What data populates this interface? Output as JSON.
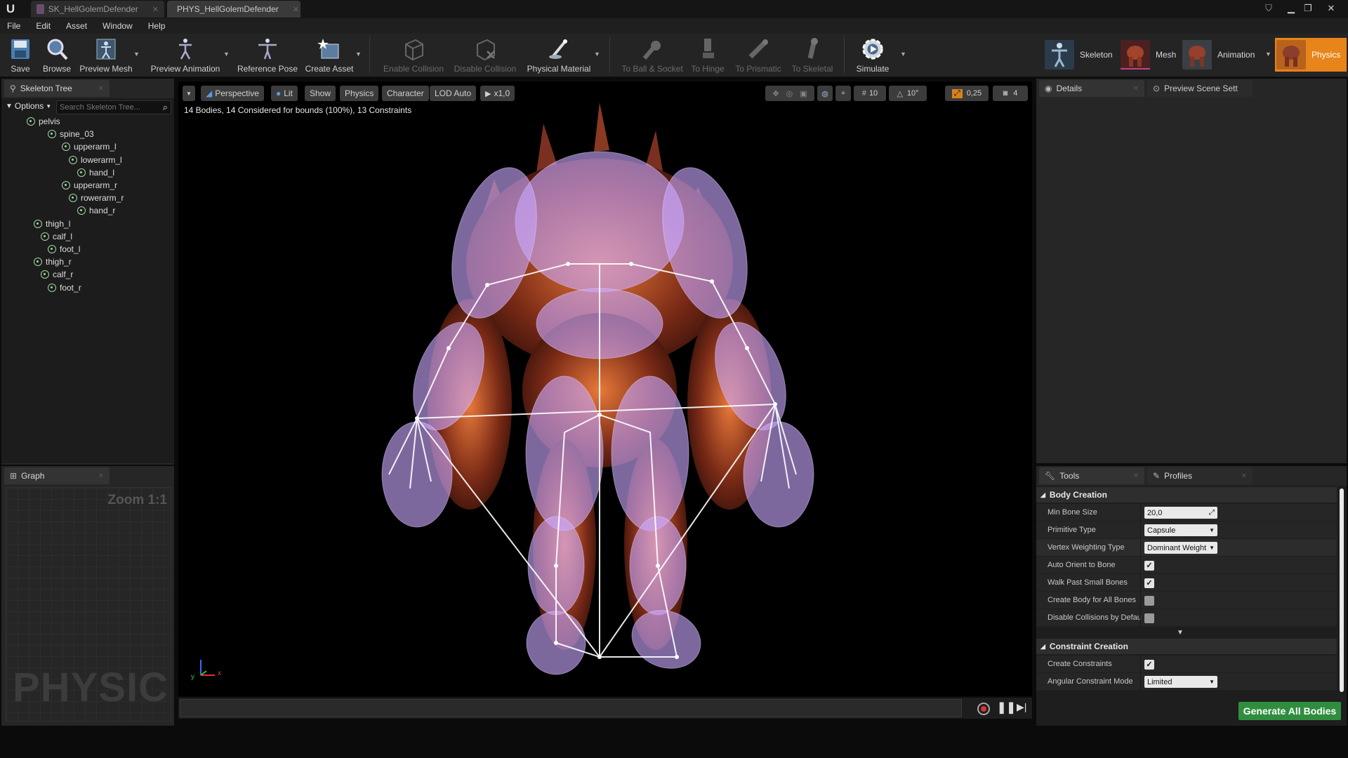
{
  "titlebar": {
    "tabs": [
      {
        "label": "SK_HellGolemDefender"
      },
      {
        "label": "PHYS_HellGolemDefender"
      }
    ]
  },
  "menu": [
    "File",
    "Edit",
    "Asset",
    "Window",
    "Help"
  ],
  "toolbar": {
    "save": "Save",
    "browse": "Browse",
    "preview_mesh": "Preview Mesh",
    "preview_animation": "Preview Animation",
    "reference_pose": "Reference Pose",
    "create_asset": "Create Asset",
    "enable_collision": "Enable Collision",
    "disable_collision": "Disable Collision",
    "physical_material": "Physical Material",
    "to_ball_socket": "To Ball & Socket",
    "to_hinge": "To Hinge",
    "to_prismatic": "To Prismatic",
    "to_skeletal": "To Skeletal",
    "simulate": "Simulate"
  },
  "modes": {
    "skeleton": "Skeleton",
    "mesh": "Mesh",
    "animation": "Animation",
    "physics": "Physics"
  },
  "skeleton_tree": {
    "tab": "Skeleton Tree",
    "options": "Options",
    "search_placeholder": "Search Skeleton Tree...",
    "bones": [
      {
        "name": "pelvis",
        "depth": 0
      },
      {
        "name": "spine_03",
        "depth": 1
      },
      {
        "name": "upperarm_l",
        "depth": 2
      },
      {
        "name": "lowerarm_l",
        "depth": 3
      },
      {
        "name": "hand_l",
        "depth": 4
      },
      {
        "name": "upperarm_r",
        "depth": 2
      },
      {
        "name": "rowerarm_r",
        "depth": 3
      },
      {
        "name": "hand_r",
        "depth": 4
      },
      {
        "name": "thigh_l",
        "depth": 0
      },
      {
        "name": "calf_l",
        "depth": 1
      },
      {
        "name": "foot_l",
        "depth": 2
      },
      {
        "name": "thigh_r",
        "depth": 0
      },
      {
        "name": "calf_r",
        "depth": 1
      },
      {
        "name": "foot_r",
        "depth": 2
      }
    ]
  },
  "graph": {
    "tab": "Graph",
    "zoom": "Zoom 1:1",
    "watermark": "PHYSICS"
  },
  "viewport": {
    "perspective": "Perspective",
    "lit": "Lit",
    "show": "Show",
    "physics": "Physics",
    "character": "Character",
    "lod": "LOD Auto",
    "speed": "x1,0",
    "grid_snap": "10",
    "rot_snap": "10°",
    "scale_snap": "0,25",
    "cam_speed": "4",
    "stats": "14 Bodies, 14 Considered for bounds (100%), 13 Constraints",
    "axis_y": "y",
    "axis_x": "x"
  },
  "details": {
    "tab": "Details",
    "preview_tab": "Preview Scene Sett"
  },
  "tools": {
    "tab": "Tools",
    "profiles_tab": "Profiles",
    "body_creation": "Body Creation",
    "min_bone_size_label": "Min Bone Size",
    "min_bone_size": "20,0",
    "primitive_type_label": "Primitive Type",
    "primitive_type": "Capsule",
    "vertex_weighting_label": "Vertex Weighting Type",
    "vertex_weighting": "Dominant Weight",
    "auto_orient_label": "Auto Orient to Bone",
    "auto_orient": true,
    "walk_past_label": "Walk Past Small Bones",
    "walk_past": true,
    "create_all_label": "Create Body for All Bones",
    "create_all": false,
    "disable_collisions_label": "Disable Collisions by Defau",
    "disable_collisions": false,
    "constraint_creation": "Constraint Creation",
    "create_constraints_label": "Create Constraints",
    "create_constraints": true,
    "angular_mode_label": "Angular Constraint Mode",
    "angular_mode": "Limited",
    "generate": "Generate All Bodies"
  }
}
